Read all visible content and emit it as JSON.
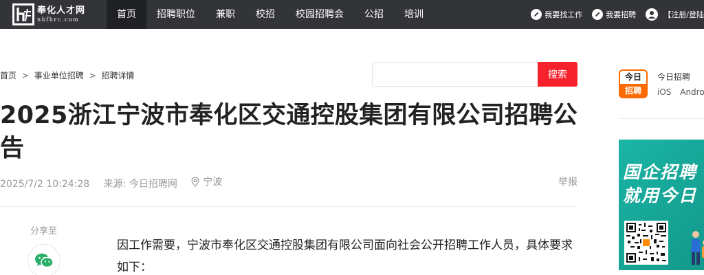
{
  "header": {
    "logo_text_cn": "奉化人才网",
    "logo_text_en": "nbfhrc.com",
    "nav": [
      {
        "label": "首页",
        "active": true
      },
      {
        "label": "招聘职位",
        "active": false
      },
      {
        "label": "兼职",
        "active": false
      },
      {
        "label": "校招",
        "active": false
      },
      {
        "label": "校园招聘会",
        "active": false
      },
      {
        "label": "公招",
        "active": false
      },
      {
        "label": "培训",
        "active": false
      }
    ],
    "find_job": "我要找工作",
    "hire": "我要招聘",
    "auth": "【注册/登陆"
  },
  "breadcrumb": {
    "home": "首页",
    "sep": ">",
    "category": "事业单位招聘",
    "current": "招聘详情"
  },
  "search": {
    "placeholder": "",
    "button": "搜索"
  },
  "article": {
    "title": "2025浙江宁波市奉化区交通控股集团有限公司招聘公告",
    "datetime": "2025/7/2 10:24:28",
    "source": "来源: 今日招聘网",
    "location": "宁波",
    "report": "举报",
    "share_label": "分享至",
    "body": "因工作需要，宁波市奉化区交通控股集团有限公司面向社会公开招聘工作人员，具体要求如下："
  },
  "sidebar": {
    "app_logo_top": "今日",
    "app_logo_bottom": "招聘",
    "app_name": "今日招聘",
    "platforms": [
      "iOS",
      "Android"
    ],
    "banner_line1": "国企招聘",
    "banner_line2": "就用今日"
  },
  "colors": {
    "topbar": "#333438",
    "nav_active": "#202124",
    "search_button": "#f5222d",
    "app_orange": "#ff6a00",
    "wechat_green": "#2aae67",
    "banner_teal": "#16a596"
  },
  "icons": {
    "find_job": "edit-icon",
    "hire": "edit-icon",
    "auth": "user-icon",
    "location": "map-pin-icon",
    "share": "wechat-icon"
  }
}
